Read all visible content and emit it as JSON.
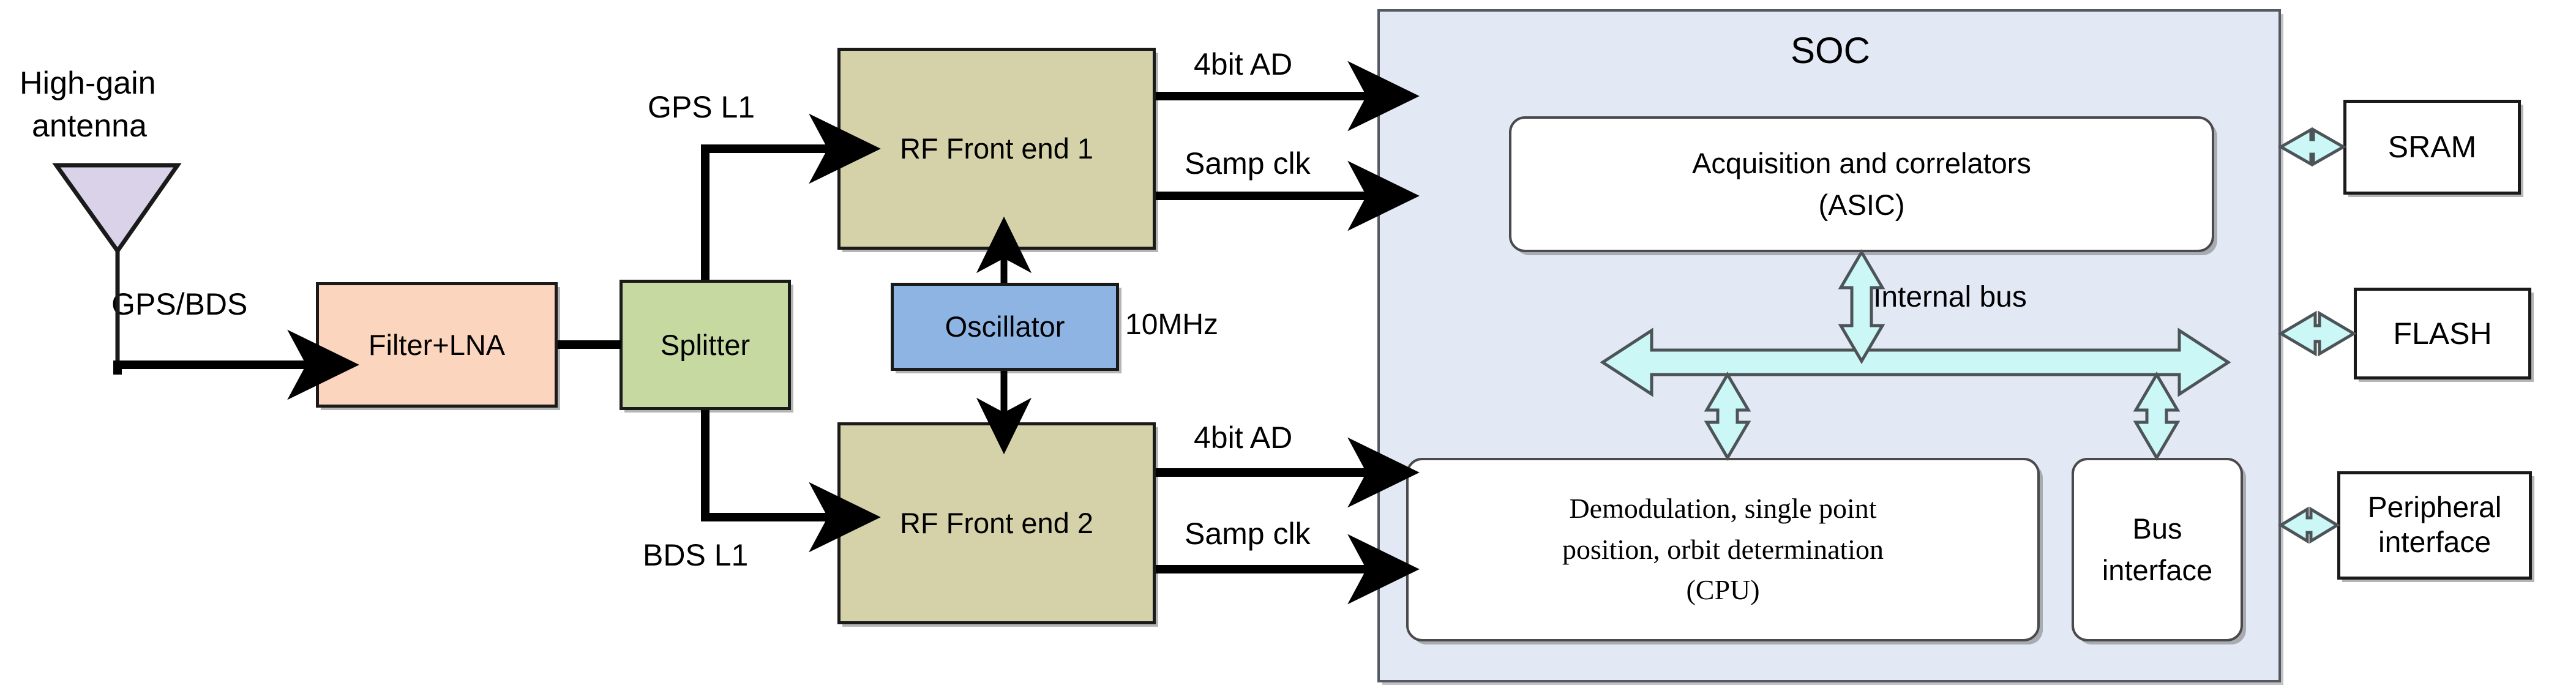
{
  "diagram": {
    "title": "GNSS receiver hardware block diagram",
    "colors": {
      "antenna_fill": "#d9d2e9",
      "filter_lna_fill": "#fbd5bd",
      "splitter_fill": "#c6d9a1",
      "rf_frontend_fill": "#d5d2aa",
      "oscillator_fill": "#8eb4e3",
      "soc_fill": "#e2e9f5",
      "inner_block_fill": "#ffffff",
      "bus_arrow_fill": "#ccf7f7",
      "outline": "#1a1a1a"
    }
  },
  "antenna": {
    "label_line1": "High-gain",
    "label_line2": "antenna",
    "icon": "antenna-triangle"
  },
  "blocks": {
    "filter_lna": {
      "label": "Filter+LNA"
    },
    "splitter": {
      "label": "Splitter"
    },
    "rf_front_end_1": {
      "label": "RF Front end 1"
    },
    "rf_front_end_2": {
      "label": "RF Front end 2"
    },
    "oscillator": {
      "label": "Oscillator",
      "freq": "10MHz"
    }
  },
  "soc": {
    "title": "SOC",
    "asic": {
      "line1": "Acquisition and correlators",
      "line2": "(ASIC)"
    },
    "cpu": {
      "line1": "Demodulation, single point",
      "line2": "position, orbit determination",
      "line3": "(CPU)"
    },
    "bus_interface": {
      "line1": "Bus",
      "line2": "interface"
    },
    "internal_bus_label": "Internal bus"
  },
  "peripherals": [
    {
      "label": "SRAM"
    },
    {
      "label": "FLASH"
    },
    {
      "label_line1": "Peripheral",
      "label_line2": "interface"
    }
  ],
  "signal_labels": {
    "antenna_to_filter": "GPS/BDS",
    "splitter_to_rf1": "GPS L1",
    "splitter_to_rf2": "BDS L1",
    "rf1_ad": "4bit AD",
    "rf1_clk": "Samp clk",
    "rf2_ad": "4bit AD",
    "rf2_clk": "Samp clk"
  }
}
